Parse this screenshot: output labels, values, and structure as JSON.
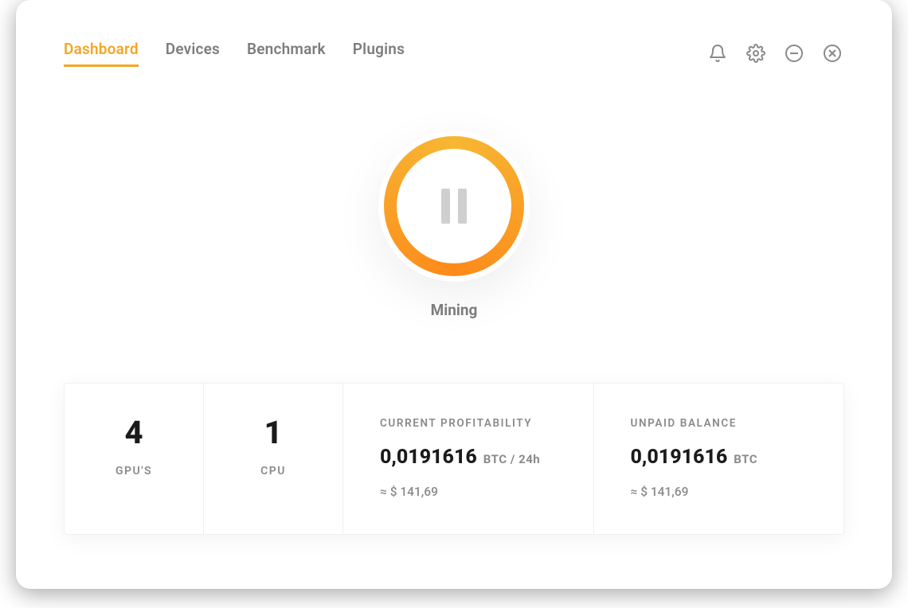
{
  "nav": {
    "items": [
      {
        "label": "Dashboard",
        "active": true
      },
      {
        "label": "Devices",
        "active": false
      },
      {
        "label": "Benchmark",
        "active": false
      },
      {
        "label": "Plugins",
        "active": false
      }
    ]
  },
  "tool_icons": {
    "notifications": "bell-icon",
    "settings": "gear-icon",
    "minimize": "minimize-icon",
    "close": "close-icon"
  },
  "hero": {
    "status": "Mining",
    "control": "pause"
  },
  "stats": {
    "gpu": {
      "count": "4",
      "label": "GPU'S"
    },
    "cpu": {
      "count": "1",
      "label": "CPU"
    },
    "profitability": {
      "kicker": "CURRENT PROFITABILITY",
      "value": "0,0191616",
      "unit": "BTC  / 24h",
      "usd": "≈ $ 141,69"
    },
    "balance": {
      "kicker": "UNPAID BALANCE",
      "value": "0,0191616",
      "unit": "BTC",
      "usd": "≈ $ 141,69"
    }
  },
  "colors": {
    "accent": "#f5a623",
    "accent_dark": "#fc8a1a",
    "muted": "#8a8a8a",
    "text": "#1b1b1b"
  }
}
